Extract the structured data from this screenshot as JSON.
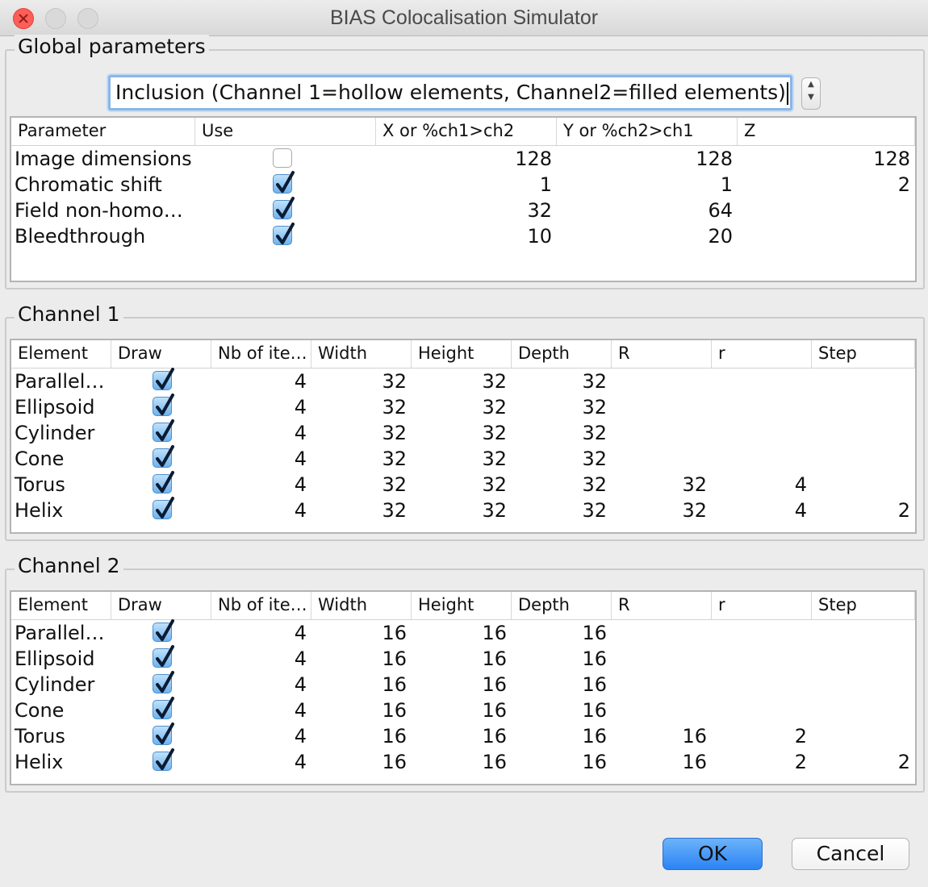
{
  "window": {
    "title": "BIAS Colocalisation Simulator"
  },
  "global": {
    "title": "Global parameters",
    "mode_value": "Inclusion (Channel 1=hollow elements, Channel2=filled elements)",
    "headers": [
      "Parameter",
      "Use",
      "X or %ch1>ch2",
      "Y or %ch2>ch1",
      "Z"
    ],
    "rows": [
      {
        "name": "Image dimensions",
        "use": false,
        "x": "128",
        "y": "128",
        "z": "128"
      },
      {
        "name": "Chromatic shift",
        "use": true,
        "x": "1",
        "y": "1",
        "z": "2"
      },
      {
        "name": "Field non-homo…",
        "use": true,
        "x": "32",
        "y": "64",
        "z": ""
      },
      {
        "name": "Bleedthrough",
        "use": true,
        "x": "10",
        "y": "20",
        "z": ""
      }
    ]
  },
  "channel1": {
    "title": "Channel 1",
    "headers": [
      "Element",
      "Draw",
      "Nb of ite…",
      "Width",
      "Height",
      "Depth",
      "R",
      "r",
      "Step"
    ],
    "rows": [
      {
        "element": "Parallel…",
        "draw": true,
        "nb": "4",
        "width": "32",
        "height": "32",
        "depth": "32",
        "R": "",
        "r": "",
        "step": ""
      },
      {
        "element": "Ellipsoid",
        "draw": true,
        "nb": "4",
        "width": "32",
        "height": "32",
        "depth": "32",
        "R": "",
        "r": "",
        "step": ""
      },
      {
        "element": "Cylinder",
        "draw": true,
        "nb": "4",
        "width": "32",
        "height": "32",
        "depth": "32",
        "R": "",
        "r": "",
        "step": ""
      },
      {
        "element": "Cone",
        "draw": true,
        "nb": "4",
        "width": "32",
        "height": "32",
        "depth": "32",
        "R": "",
        "r": "",
        "step": ""
      },
      {
        "element": "Torus",
        "draw": true,
        "nb": "4",
        "width": "32",
        "height": "32",
        "depth": "32",
        "R": "32",
        "r": "4",
        "step": ""
      },
      {
        "element": "Helix",
        "draw": true,
        "nb": "4",
        "width": "32",
        "height": "32",
        "depth": "32",
        "R": "32",
        "r": "4",
        "step": "2"
      }
    ]
  },
  "channel2": {
    "title": "Channel 2",
    "headers": [
      "Element",
      "Draw",
      "Nb of ite…",
      "Width",
      "Height",
      "Depth",
      "R",
      "r",
      "Step"
    ],
    "rows": [
      {
        "element": "Parallel…",
        "draw": true,
        "nb": "4",
        "width": "16",
        "height": "16",
        "depth": "16",
        "R": "",
        "r": "",
        "step": ""
      },
      {
        "element": "Ellipsoid",
        "draw": true,
        "nb": "4",
        "width": "16",
        "height": "16",
        "depth": "16",
        "R": "",
        "r": "",
        "step": ""
      },
      {
        "element": "Cylinder",
        "draw": true,
        "nb": "4",
        "width": "16",
        "height": "16",
        "depth": "16",
        "R": "",
        "r": "",
        "step": ""
      },
      {
        "element": "Cone",
        "draw": true,
        "nb": "4",
        "width": "16",
        "height": "16",
        "depth": "16",
        "R": "",
        "r": "",
        "step": ""
      },
      {
        "element": "Torus",
        "draw": true,
        "nb": "4",
        "width": "16",
        "height": "16",
        "depth": "16",
        "R": "16",
        "r": "2",
        "step": ""
      },
      {
        "element": "Helix",
        "draw": true,
        "nb": "4",
        "width": "16",
        "height": "16",
        "depth": "16",
        "R": "16",
        "r": "2",
        "step": "2"
      }
    ]
  },
  "buttons": {
    "ok": "OK",
    "cancel": "Cancel"
  },
  "colors": {
    "accent": "#3b8ef5",
    "focus_ring": "#8ab6e8",
    "checkbox_fill": "#6fb3ee",
    "close_light": "#fd5e57"
  }
}
